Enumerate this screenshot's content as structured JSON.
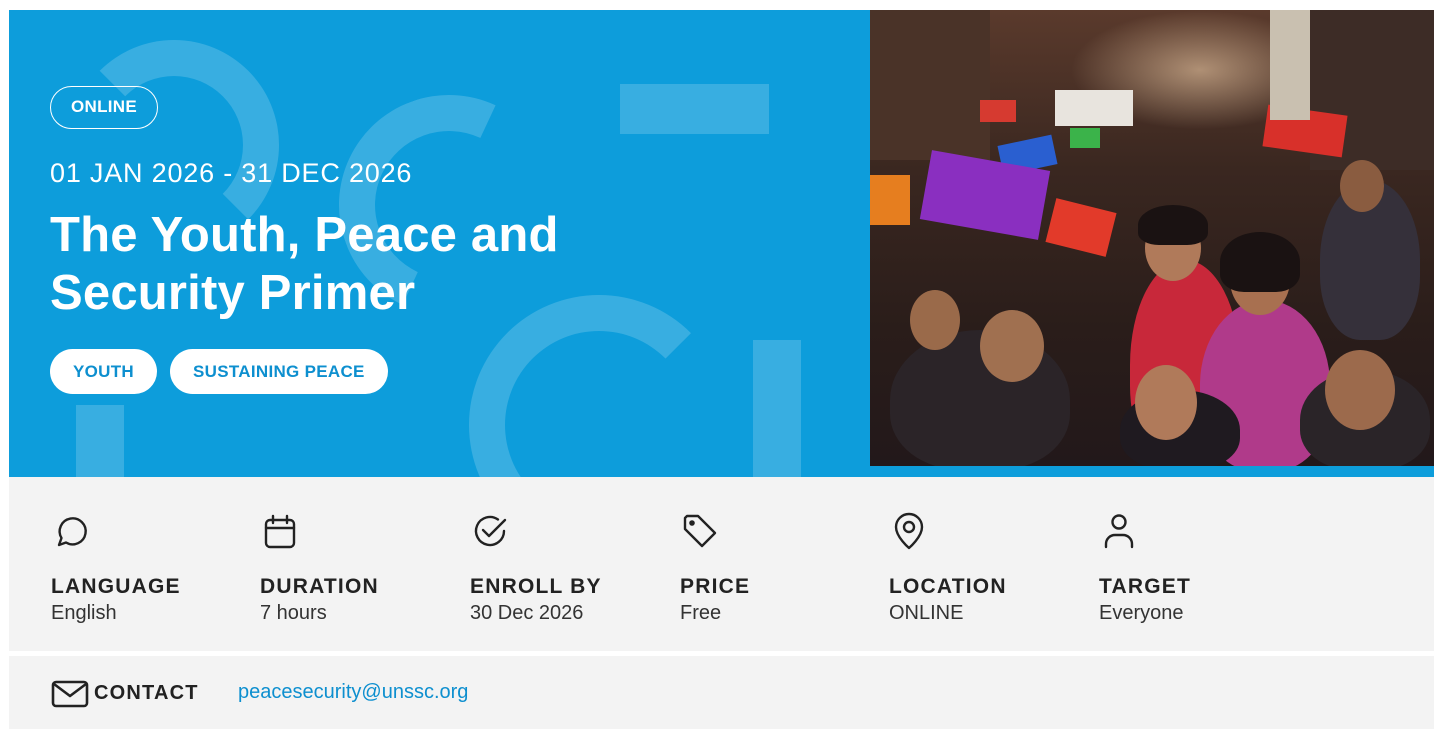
{
  "hero": {
    "mode_badge": "ONLINE",
    "dates": "01 JAN 2026 - 31 DEC 2026",
    "title": "The Youth, Peace and Security Primer",
    "tags": [
      "YOUTH",
      "SUSTAINING PEACE"
    ],
    "accent_color": "#0d9ddb"
  },
  "details": [
    {
      "icon": "chat-bubble-icon",
      "label": "LANGUAGE",
      "value": "English"
    },
    {
      "icon": "calendar-icon",
      "label": "DURATION",
      "value": "7 hours"
    },
    {
      "icon": "check-circle-icon",
      "label": "ENROLL BY",
      "value": "30 Dec 2026"
    },
    {
      "icon": "price-tag-icon",
      "label": "PRICE",
      "value": "Free"
    },
    {
      "icon": "location-pin-icon",
      "label": "LOCATION",
      "value": "ONLINE"
    },
    {
      "icon": "person-icon",
      "label": "TARGET",
      "value": "Everyone"
    }
  ],
  "contact": {
    "icon": "envelope-icon",
    "label": "CONTACT",
    "email": "peacesecurity@unssc.org",
    "link_color": "#0d8fcf"
  }
}
